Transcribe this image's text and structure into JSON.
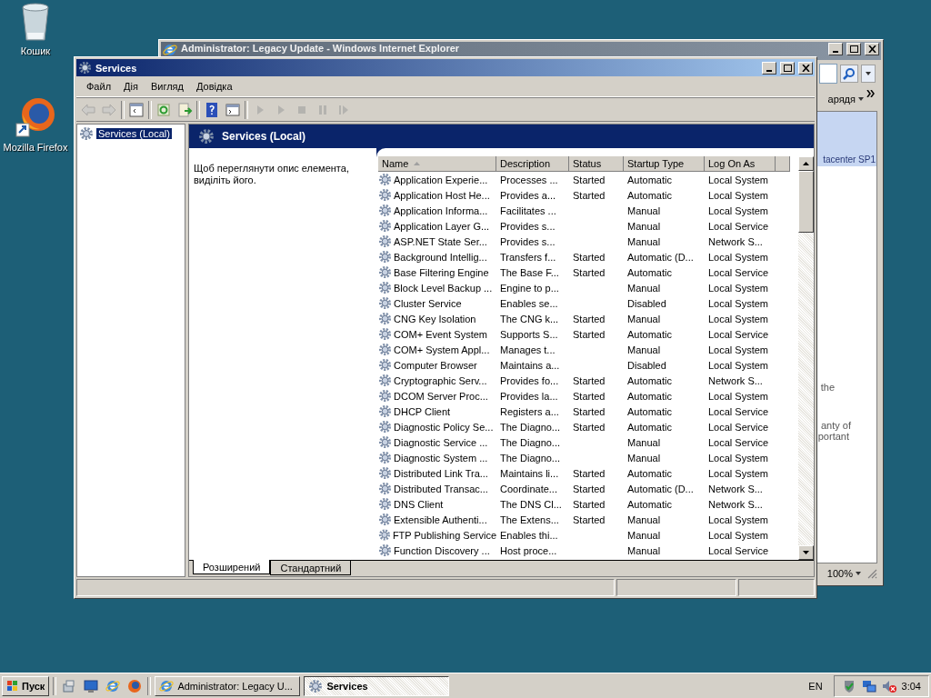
{
  "desktop_icons": [
    {
      "label": "Кошик",
      "kind": "recycle"
    },
    {
      "label": "Mozilla Firefox",
      "kind": "firefox"
    }
  ],
  "background_window": {
    "title": "Administrator: Legacy Update - Windows Internet Explorer",
    "toolbar_label": "арядя",
    "banner_text": "tacenter SP1",
    "body_lines": [
      "the",
      "anty of",
      "portant"
    ],
    "zoom": "100%"
  },
  "window": {
    "title": "Services",
    "menu": [
      "Файл",
      "Дія",
      "Вигляд",
      "Довідка"
    ],
    "toolbar": [
      {
        "kind": "back",
        "disabled": true
      },
      {
        "kind": "forward",
        "disabled": true
      },
      {
        "kind": "tree",
        "disabled": false
      },
      {
        "kind": "refresh",
        "disabled": false
      },
      {
        "kind": "export",
        "disabled": false
      },
      {
        "kind": "help",
        "disabled": false
      },
      {
        "kind": "properties",
        "disabled": false
      },
      {
        "kind": "start",
        "disabled": true
      },
      {
        "kind": "start",
        "disabled": true
      },
      {
        "kind": "stop",
        "disabled": true
      },
      {
        "kind": "pause",
        "disabled": true
      },
      {
        "kind": "resume",
        "disabled": true
      }
    ],
    "tree": [
      {
        "label": "Services (Local)",
        "selected": true
      }
    ],
    "panel": {
      "title": "Services (Local)",
      "hint": "Щоб переглянути опис елемента, виділіть його."
    },
    "table": {
      "columns": [
        {
          "label": "Name",
          "sorted": true
        },
        {
          "label": "Description",
          "sorted": false
        },
        {
          "label": "Status",
          "sorted": false
        },
        {
          "label": "Startup Type",
          "sorted": false
        },
        {
          "label": "Log On As",
          "sorted": false
        }
      ],
      "rows": [
        [
          "Application Experie...",
          "Processes ...",
          "Started",
          "Automatic",
          "Local System"
        ],
        [
          "Application Host He...",
          "Provides a...",
          "Started",
          "Automatic",
          "Local System"
        ],
        [
          "Application Informa...",
          "Facilitates ...",
          "",
          "Manual",
          "Local System"
        ],
        [
          "Application Layer G...",
          "Provides s...",
          "",
          "Manual",
          "Local Service"
        ],
        [
          "ASP.NET State Ser...",
          "Provides s...",
          "",
          "Manual",
          "Network S..."
        ],
        [
          "Background Intellig...",
          "Transfers f...",
          "Started",
          "Automatic (D...",
          "Local System"
        ],
        [
          "Base Filtering Engine",
          "The Base F...",
          "Started",
          "Automatic",
          "Local Service"
        ],
        [
          "Block Level Backup ...",
          "Engine to p...",
          "",
          "Manual",
          "Local System"
        ],
        [
          "Cluster Service",
          "Enables se...",
          "",
          "Disabled",
          "Local System"
        ],
        [
          "CNG Key Isolation",
          "The CNG k...",
          "Started",
          "Manual",
          "Local System"
        ],
        [
          "COM+ Event System",
          "Supports S...",
          "Started",
          "Automatic",
          "Local Service"
        ],
        [
          "COM+ System Appl...",
          "Manages t...",
          "",
          "Manual",
          "Local System"
        ],
        [
          "Computer Browser",
          "Maintains a...",
          "",
          "Disabled",
          "Local System"
        ],
        [
          "Cryptographic Serv...",
          "Provides fo...",
          "Started",
          "Automatic",
          "Network S..."
        ],
        [
          "DCOM Server Proc...",
          "Provides la...",
          "Started",
          "Automatic",
          "Local System"
        ],
        [
          "DHCP Client",
          "Registers a...",
          "Started",
          "Automatic",
          "Local Service"
        ],
        [
          "Diagnostic Policy Se...",
          "The Diagno...",
          "Started",
          "Automatic",
          "Local Service"
        ],
        [
          "Diagnostic Service ...",
          "The Diagno...",
          "",
          "Manual",
          "Local Service"
        ],
        [
          "Diagnostic System ...",
          "The Diagno...",
          "",
          "Manual",
          "Local System"
        ],
        [
          "Distributed Link Tra...",
          "Maintains li...",
          "Started",
          "Automatic",
          "Local System"
        ],
        [
          "Distributed Transac...",
          "Coordinate...",
          "Started",
          "Automatic (D...",
          "Network S..."
        ],
        [
          "DNS Client",
          "The DNS Cl...",
          "Started",
          "Automatic",
          "Network S..."
        ],
        [
          "Extensible Authenti...",
          "The Extens...",
          "Started",
          "Manual",
          "Local System"
        ],
        [
          "FTP Publishing Service",
          "Enables thi...",
          "",
          "Manual",
          "Local System"
        ],
        [
          "Function Discovery ...",
          "Host proce...",
          "",
          "Manual",
          "Local Service"
        ]
      ]
    },
    "view_tabs": [
      {
        "label": "Розширений",
        "selected": true
      },
      {
        "label": "Стандартний",
        "selected": false
      }
    ]
  },
  "taskbar": {
    "start": "Пуск",
    "tasks": [
      {
        "label": "Administrator: Legacy U...",
        "kind": "ie",
        "selected": false
      },
      {
        "label": "Services",
        "kind": "services",
        "selected": true
      }
    ],
    "language": "EN",
    "clock": "3:04"
  }
}
